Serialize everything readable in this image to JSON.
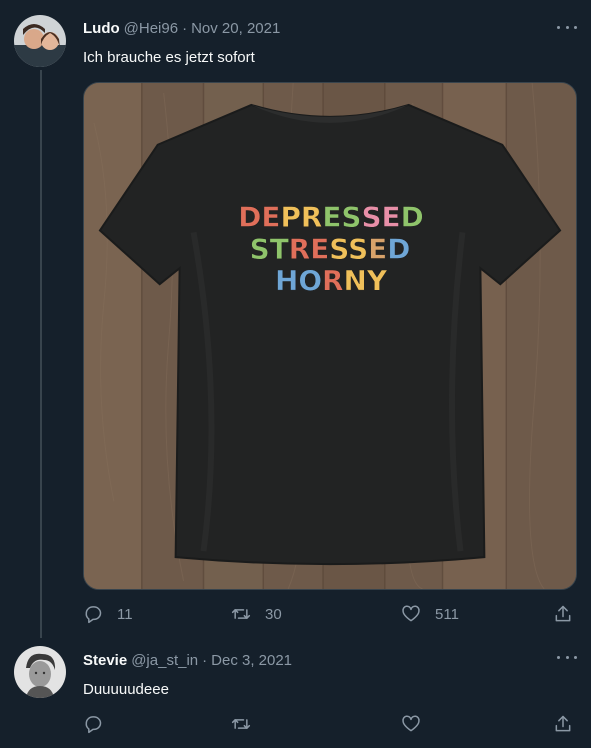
{
  "tweets": [
    {
      "name": "Ludo",
      "handle": "@Hei96",
      "separator": "·",
      "date": "Nov 20, 2021",
      "text": "Ich brauche es jetzt sofort",
      "shirt_lines": [
        "DEPRESSED",
        "STRESSED",
        "HORNY"
      ],
      "replies": "11",
      "retweets": "30",
      "likes": "511"
    },
    {
      "name": "Stevie",
      "handle": "@ja_st_in",
      "separator": "·",
      "date": "Dec 3, 2021",
      "text": "Duuuuudeee",
      "replies": "",
      "retweets": "",
      "likes": ""
    }
  ],
  "icons": {
    "reply": "reply-icon",
    "retweet": "retweet-icon",
    "like": "heart-icon",
    "share": "share-icon",
    "more": "more-icon"
  },
  "colors": {
    "background": "#15202b",
    "secondary_text": "#8b98a5",
    "shirt_letters": [
      "#e06f5a",
      "#f0c05a",
      "#8fc46b",
      "#6fa6d6",
      "#e88fa8",
      "#d8a26a"
    ]
  }
}
